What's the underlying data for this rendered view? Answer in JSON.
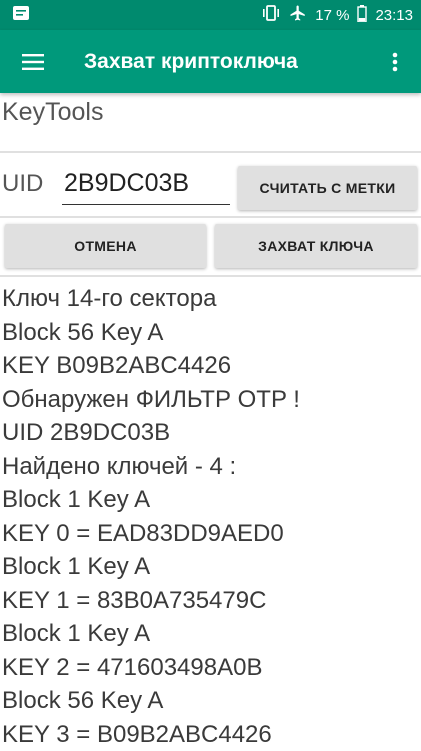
{
  "status_bar": {
    "battery": "17 %",
    "time": "23:13",
    "icons": [
      "notification-icon",
      "vibrate-icon",
      "airplane-mode-icon",
      "battery-icon"
    ]
  },
  "app_bar": {
    "title": "Захват криптоключа",
    "menu_icon": "menu-icon",
    "more_icon": "more-vert-icon"
  },
  "app_name": "KeyTools",
  "uid": {
    "label": "UID",
    "value": "2B9DC03B"
  },
  "buttons": {
    "read_tag": "СЧИТАТЬ С  МЕТКИ",
    "cancel": "ОТМЕНА",
    "capture": "ЗАХВАТ КЛЮЧА"
  },
  "log": [
    "Ключ 14-го сектора",
    "Block 56 Key A",
    "KEY  B09B2ABC4426",
    "Обнаружен ФИЛЬТР OTP !",
    "UID 2B9DC03B",
    "Найдено ключей - 4 :",
    "Block 1 Key A",
    "KEY 0 = EAD83DD9AED0",
    "Block 1 Key A",
    "KEY 1 = 83B0A735479C",
    "Block 1 Key A",
    "KEY 2 = 471603498A0B",
    "Block 56 Key A",
    "KEY 3 = B09B2ABC4426"
  ],
  "colors": {
    "status_bar": "#008a6e",
    "app_bar": "#00997b",
    "button": "#e0e0e0",
    "text": "#3a3a3a"
  }
}
